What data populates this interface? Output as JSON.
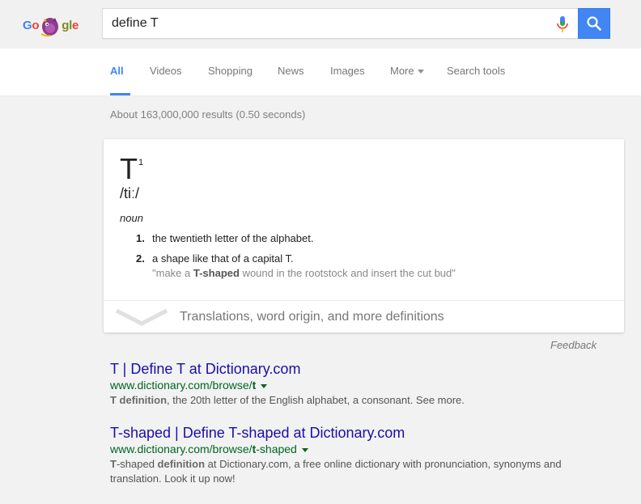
{
  "logo": {
    "text_g": "G",
    "text_o": "o",
    "text_gl": "gl",
    "text_e": "e"
  },
  "search": {
    "query": "define T"
  },
  "tabs": [
    {
      "label": "All"
    },
    {
      "label": "Videos"
    },
    {
      "label": "Shopping"
    },
    {
      "label": "News"
    },
    {
      "label": "Images"
    },
    {
      "label": "More"
    },
    {
      "label": "Search tools"
    }
  ],
  "stats": "About 163,000,000 results (0.50 seconds)",
  "definition": {
    "word": "T",
    "superscript": "1",
    "phonetic": "/tiː/",
    "part_of_speech": "noun",
    "senses": [
      {
        "num": "1.",
        "text": "the twentieth letter of the alphabet."
      },
      {
        "num": "2.",
        "text": "a shape like that of a capital T.",
        "example_pre": "\"make a ",
        "example_bold": "T-shaped",
        "example_post": " wound in the rootstock and insert the cut bud\""
      }
    ],
    "more_label": "Translations, word origin, and more definitions"
  },
  "feedback": "Feedback",
  "results": [
    {
      "title": "T | Define T at Dictionary.com",
      "url_pre": "www.dictionary.com/browse/",
      "url_bold": "t",
      "snippet_bold": "T definition",
      "snippet_rest": ", the 20th letter of the English alphabet, a consonant. See more."
    },
    {
      "title": "T-shaped | Define T-shaped at Dictionary.com",
      "url_pre": "www.dictionary.com/browse/",
      "url_bold": "t",
      "url_post": "-shaped",
      "snippet_b1": "T",
      "snippet_t1": "-shaped ",
      "snippet_b2": "definition",
      "snippet_t2": " at Dictionary.com, a free online dictionary with pronunciation, synonyms and translation. Look it up now!"
    }
  ],
  "colors": {
    "accent": "#4285f4",
    "link": "#1a0dab",
    "url": "#006621"
  }
}
